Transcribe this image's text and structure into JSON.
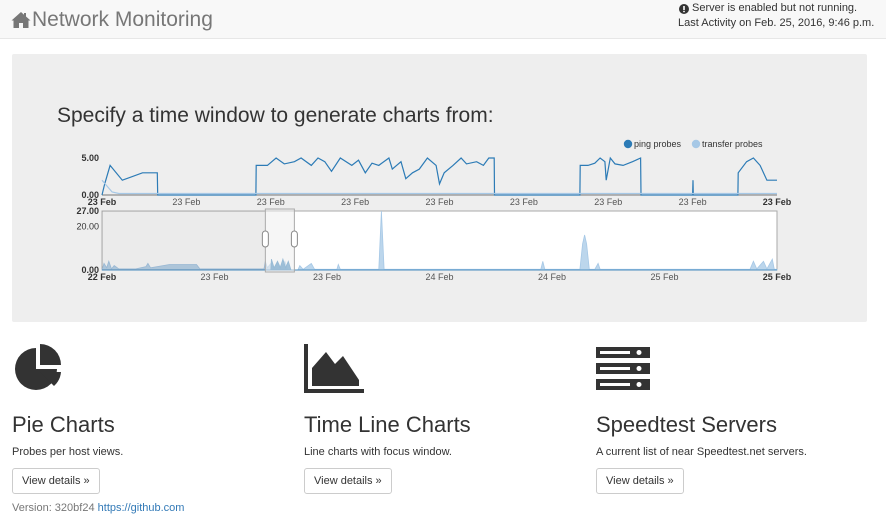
{
  "navbar": {
    "brand": "Network Monitoring",
    "brand_icon": "home-icon",
    "status_icon": "exclamation-circle-icon",
    "status_line1": "Server is enabled but not running.",
    "status_line2": "Last Activity on Feb. 25, 2016, 9:46 p.m."
  },
  "jumbotron": {
    "heading": "Specify a time window to generate charts from:"
  },
  "chart_data": [
    {
      "type": "line",
      "role": "focus",
      "legend_position": "top-right",
      "series": [
        {
          "name": "ping probes",
          "color": "#2c7bb6",
          "points": [
            [
              0.0,
              0
            ],
            [
              0.4,
              1.5
            ],
            [
              1.2,
              4.0
            ],
            [
              3.0,
              2.0
            ],
            [
              6.0,
              3.0
            ],
            [
              8.2,
              3.0
            ],
            [
              8.25,
              0
            ],
            [
              22.8,
              0
            ],
            [
              22.85,
              4.0
            ],
            [
              24.5,
              4.0
            ],
            [
              25.8,
              5.0
            ],
            [
              27,
              4.2
            ],
            [
              28.5,
              4.5
            ],
            [
              29.5,
              5.0
            ],
            [
              31,
              4.0
            ],
            [
              32,
              5.0
            ],
            [
              33,
              4.5
            ],
            [
              34,
              3.2
            ],
            [
              35.3,
              5.0
            ],
            [
              37,
              4.0
            ],
            [
              38,
              4.7
            ],
            [
              39,
              3.0
            ],
            [
              40,
              4.3
            ],
            [
              41,
              4.0
            ],
            [
              42.5,
              5.0
            ],
            [
              43,
              3.5
            ],
            [
              44.3,
              4.5
            ],
            [
              45,
              2.2
            ],
            [
              46,
              3.0
            ],
            [
              47,
              3.5
            ],
            [
              48.2,
              5.0
            ],
            [
              49.5,
              4.0
            ],
            [
              50,
              1.5
            ],
            [
              50.7,
              3.0
            ],
            [
              52,
              4.0
            ],
            [
              53.2,
              5.0
            ],
            [
              54,
              4.2
            ],
            [
              55.5,
              4.5
            ],
            [
              56.5,
              4.0
            ],
            [
              57.3,
              5.0
            ],
            [
              58.1,
              5.0
            ],
            [
              58.15,
              0
            ],
            [
              70.8,
              0
            ],
            [
              70.85,
              4.0
            ],
            [
              72,
              4.0
            ],
            [
              73,
              4.3
            ],
            [
              73.8,
              5.0
            ],
            [
              74.5,
              4.5
            ],
            [
              74.7,
              2.0
            ],
            [
              75.3,
              5.0
            ],
            [
              76,
              4.2
            ],
            [
              77.2,
              4.0
            ],
            [
              78.6,
              4.5
            ],
            [
              79.8,
              5.0
            ],
            [
              79.85,
              0
            ],
            [
              87.5,
              0
            ],
            [
              87.55,
              2.0
            ],
            [
              87.6,
              0
            ],
            [
              94.2,
              0
            ],
            [
              94.25,
              3.0
            ],
            [
              95.5,
              4.5
            ],
            [
              96.5,
              5.0
            ],
            [
              97.5,
              4.0
            ],
            [
              98.5,
              2.0
            ],
            [
              100,
              2.0
            ]
          ]
        },
        {
          "name": "transfer probes",
          "color": "#a6c8e6",
          "points": [
            [
              0,
              2.0
            ],
            [
              1.5,
              0.4
            ],
            [
              2.5,
              0.2
            ],
            [
              100,
              0.2
            ]
          ]
        }
      ],
      "y_ticks": [
        "5.00",
        "0.00"
      ],
      "ylim": [
        0,
        5
      ],
      "x_ticks": [
        "23 Feb",
        "23 Feb",
        "23 Feb",
        "23 Feb",
        "23 Feb",
        "23 Feb",
        "23 Feb",
        "23 Feb",
        "23 Feb"
      ]
    },
    {
      "type": "area",
      "role": "context",
      "series": [
        {
          "name": "transfer probes",
          "color": "#a6c8e6",
          "points": [
            [
              0,
              0
            ],
            [
              0.3,
              3
            ],
            [
              0.7,
              1
            ],
            [
              1.0,
              4
            ],
            [
              1.4,
              0.5
            ],
            [
              1.8,
              2
            ],
            [
              2.5,
              0.5
            ],
            [
              5,
              0.5
            ],
            [
              6.5,
              1.5
            ],
            [
              6.8,
              3
            ],
            [
              7.2,
              1
            ],
            [
              10,
              2.5
            ],
            [
              14,
              2.5
            ],
            [
              14.5,
              0.5
            ],
            [
              24,
              0.5
            ],
            [
              24.2,
              4
            ],
            [
              24.5,
              1
            ],
            [
              25,
              3
            ],
            [
              25.5,
              0.5
            ],
            [
              26,
              4
            ],
            [
              26.5,
              1
            ],
            [
              27.1,
              4
            ],
            [
              27.5,
              0
            ],
            [
              29,
              0
            ],
            [
              29.3,
              2
            ],
            [
              29.8,
              0.3
            ],
            [
              31,
              3
            ],
            [
              31.5,
              0.3
            ],
            [
              34.8,
              0.3
            ],
            [
              35,
              2.5
            ],
            [
              35.3,
              0.3
            ],
            [
              41,
              0.3
            ],
            [
              41.4,
              27
            ],
            [
              41.8,
              0.3
            ],
            [
              65,
              0.3
            ],
            [
              65.3,
              4
            ],
            [
              65.6,
              0.3
            ],
            [
              70.8,
              0.3
            ],
            [
              71.2,
              12
            ],
            [
              71.5,
              16
            ],
            [
              71.8,
              12
            ],
            [
              72.2,
              0.3
            ],
            [
              73,
              0.3
            ],
            [
              73.5,
              3
            ],
            [
              73.8,
              0.3
            ],
            [
              96,
              0.3
            ],
            [
              96.5,
              4
            ],
            [
              97,
              0.5
            ],
            [
              98,
              4
            ],
            [
              98.5,
              0.5
            ],
            [
              99.3,
              5
            ],
            [
              99.6,
              0.3
            ],
            [
              100,
              0.3
            ]
          ]
        },
        {
          "name": "ping probes",
          "color": "#2c7bb6",
          "points": [
            [
              0,
              0
            ],
            [
              25,
              0
            ],
            [
              25.1,
              5
            ],
            [
              25.5,
              1
            ],
            [
              26,
              4
            ],
            [
              26.4,
              1
            ],
            [
              26.8,
              5
            ],
            [
              27.2,
              1
            ],
            [
              27.6,
              4
            ],
            [
              28,
              0
            ],
            [
              100,
              0
            ]
          ]
        }
      ],
      "y_ticks": [
        "27.00",
        "20.00",
        "0.00"
      ],
      "ylim": [
        0,
        27
      ],
      "x_ticks": [
        "22 Feb",
        "23 Feb",
        "23 Feb",
        "24 Feb",
        "24 Feb",
        "25 Feb",
        "25 Feb"
      ],
      "brush_range": [
        24.2,
        28.5
      ]
    }
  ],
  "features": [
    {
      "icon": "pie-chart-icon",
      "title": "Pie Charts",
      "desc": "Probes per host views.",
      "button": "View details »"
    },
    {
      "icon": "area-chart-icon",
      "title": "Time Line Charts",
      "desc": "Line charts with focus window.",
      "button": "View details »"
    },
    {
      "icon": "server-stack-icon",
      "title": "Speedtest Servers",
      "desc": "A current list of near Speedtest.net servers.",
      "button": "View details »"
    }
  ],
  "footer": {
    "version": "Version: 320bf24",
    "link": "https://github.com"
  }
}
